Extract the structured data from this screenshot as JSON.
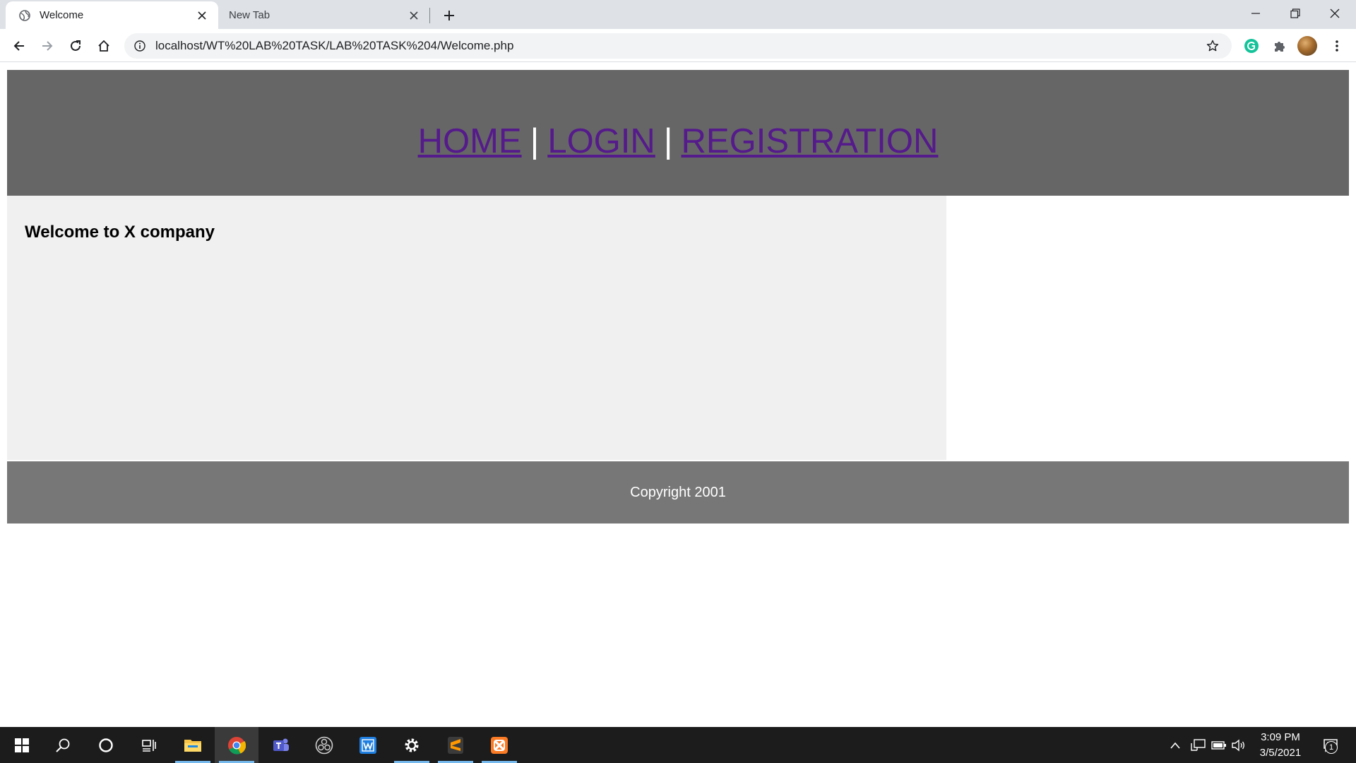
{
  "browser": {
    "tabs": [
      {
        "title": "Welcome",
        "active": true,
        "icon": "globe-icon"
      },
      {
        "title": "New Tab",
        "active": false
      }
    ],
    "address_bar": {
      "url": "localhost/WT%20LAB%20TASK/LAB%20TASK%204/Welcome.php"
    }
  },
  "site": {
    "nav": {
      "home": "HOME",
      "login": "LOGIN",
      "registration": "REGISTRATION",
      "separator": "|"
    },
    "main": {
      "heading": "Welcome to X company"
    },
    "footer": {
      "copyright": "Copyright 2001"
    }
  },
  "taskbar": {
    "apps": [
      "windows-start-icon",
      "search-icon",
      "cortana-icon",
      "task-view-icon",
      "file-explorer-icon",
      "chrome-icon",
      "teams-icon",
      "obs-icon",
      "writer-icon",
      "settings-icon",
      "sublime-icon",
      "xampp-icon"
    ],
    "clock": {
      "time": "3:09 PM",
      "date": "3/5/2021"
    },
    "notification_count": "1"
  },
  "colors": {
    "header_bg": "#666666",
    "nav_link": "#551a8b",
    "main_bg": "#f0f0f0",
    "footer_bg": "#777777",
    "taskbar_bg": "#1c1c1c"
  }
}
